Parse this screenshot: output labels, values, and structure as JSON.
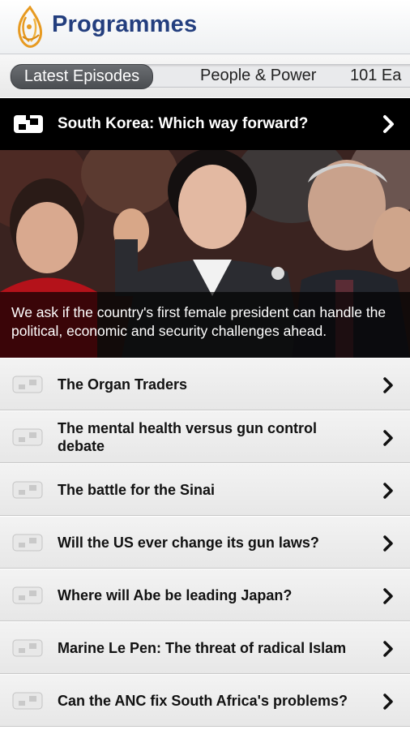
{
  "header": {
    "title": "Programmes"
  },
  "tabs": [
    {
      "label": "Latest Episodes",
      "active": true
    },
    {
      "label": "People & Power",
      "active": false
    },
    {
      "label": "101 Ea",
      "active": false
    }
  ],
  "featured": {
    "title": "South Korea: Which way forward?",
    "caption": "We ask if the country's first female president can handle the political, economic and security challenges ahead.",
    "icon": "video-icon"
  },
  "episodes": [
    {
      "title": "The Organ Traders"
    },
    {
      "title": "The mental health versus gun control debate"
    },
    {
      "title": "The battle for the Sinai"
    },
    {
      "title": "Will the US ever change its gun laws?"
    },
    {
      "title": "Where will Abe be leading Japan?"
    },
    {
      "title": "Marine Le Pen: The threat of radical Islam"
    },
    {
      "title": "Can the ANC fix South Africa's problems?"
    }
  ],
  "colors": {
    "brand_blue": "#233e7e",
    "logo_orange": "#e79a21"
  }
}
